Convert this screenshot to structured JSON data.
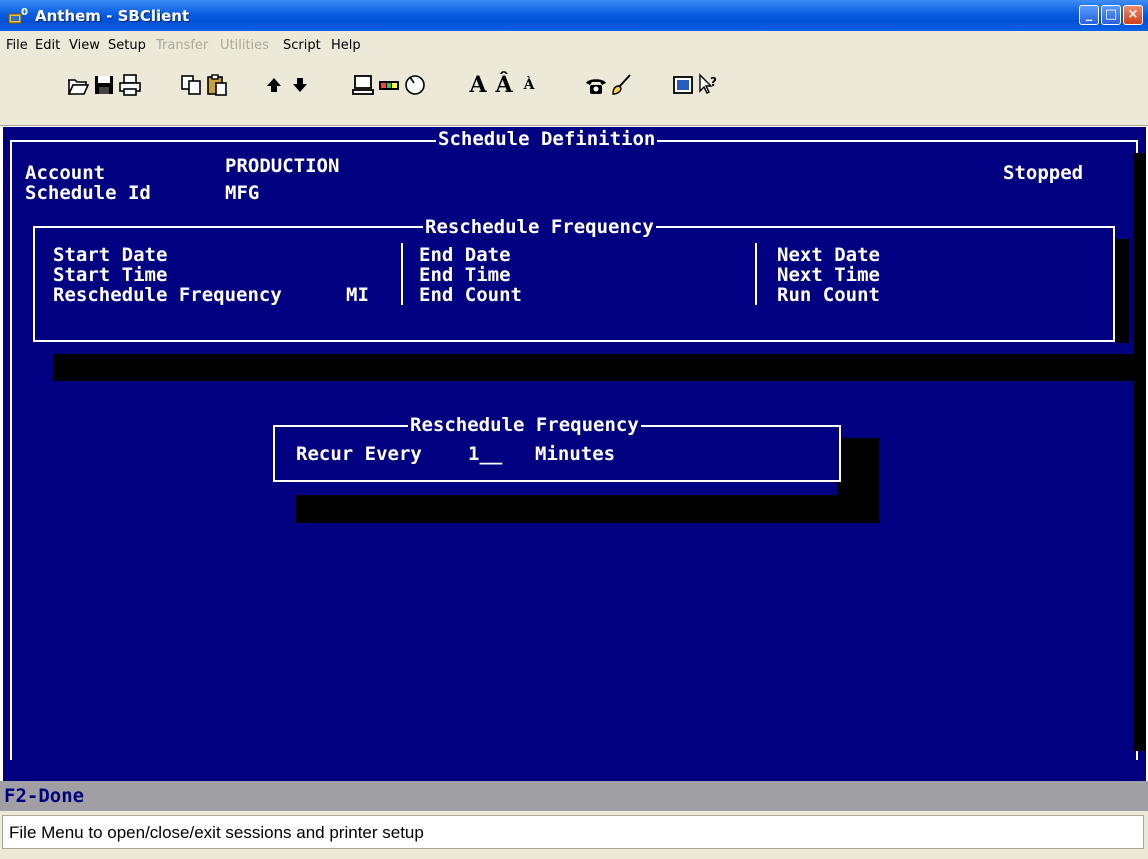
{
  "window": {
    "title": "Anthem - SBClient",
    "minimize_label": "_",
    "maximize_label": "□",
    "close_label": "×"
  },
  "menu": {
    "items": [
      {
        "label": "File",
        "enabled": true
      },
      {
        "label": "Edit",
        "enabled": true
      },
      {
        "label": "View",
        "enabled": true
      },
      {
        "label": "Setup",
        "enabled": true
      },
      {
        "label": "Transfer",
        "enabled": false
      },
      {
        "label": "Utilities",
        "enabled": false
      },
      {
        "label": "Script",
        "enabled": true
      },
      {
        "label": "Help",
        "enabled": true
      }
    ]
  },
  "toolbar": {
    "icons": [
      "open-icon",
      "save-icon",
      "print-icon",
      "copy-icon",
      "paste-icon",
      "arrow-up-icon",
      "arrow-down-icon",
      "terminal-icon",
      "color-icon",
      "shape-icon",
      "font-normal-icon",
      "font-larger-icon",
      "font-smaller-icon",
      "phone-icon",
      "brush-icon",
      "monitor-icon",
      "help-pointer-icon"
    ]
  },
  "screen": {
    "main_title": "Schedule Definition",
    "account_label": "Account",
    "account_value": "PRODUCTION",
    "status": "Stopped",
    "schedule_id_label": "Schedule Id",
    "schedule_id_value": "MFG",
    "freq_box_title": "Reschedule Frequency",
    "start_date_label": "Start Date",
    "start_time_label": "Start Time",
    "resched_freq_label": "Reschedule Frequency",
    "resched_freq_value": "MI",
    "end_date_label": "End Date",
    "end_time_label": "End Time",
    "end_count_label": "End Count",
    "next_date_label": "Next Date",
    "next_time_label": "Next Time",
    "run_count_label": "Run Count",
    "dialog_title": "Reschedule Frequency",
    "recur_label": "Recur Every",
    "recur_value": "1__",
    "recur_unit": "Minutes"
  },
  "fkey_bar": "F2-Done",
  "status_bar": "File Menu to open/close/exit sessions and printer setup"
}
